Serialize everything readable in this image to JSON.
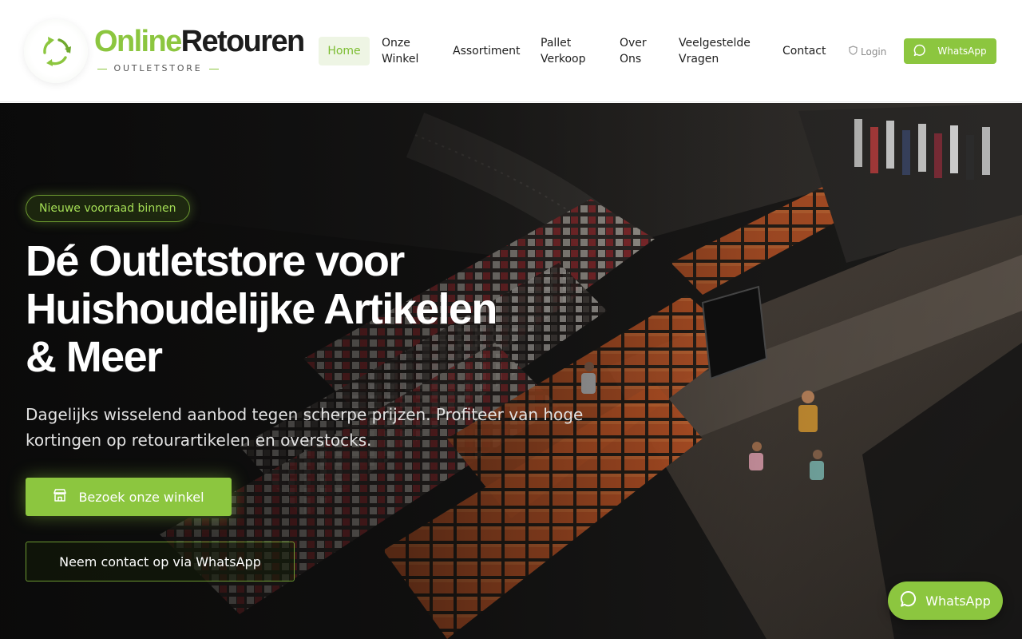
{
  "brand": {
    "name_part1": "Online",
    "name_part2": "Retouren",
    "tagline": "OUTLETSTORE",
    "accent_color": "#8cc63f",
    "logo_icon": "recycle-arrows-icon"
  },
  "nav": {
    "items": [
      {
        "label": "Home",
        "active": true
      },
      {
        "label": "Onze Winkel"
      },
      {
        "label": "Assortiment"
      },
      {
        "label": "Pallet Verkoop"
      },
      {
        "label": "Over Ons"
      },
      {
        "label": "Veelgestelde Vragen"
      },
      {
        "label": "Contact"
      }
    ],
    "login_label": "Login",
    "login_icon": "shield-icon",
    "whatsapp_label": "WhatsApp",
    "whatsapp_icon": "chat-bubble-icon"
  },
  "hero": {
    "badge": "Nieuwe voorraad binnen",
    "title": "Dé Outletstore voor Huishoudelijke Artikelen & Meer",
    "description": "Dagelijks wisselend aanbod tegen scherpe prijzen. Profiteer van hoge kortingen op retourartikelen en overstocks.",
    "primary_button": "Bezoek onze winkel",
    "primary_button_icon": "storefront-icon",
    "secondary_button": "Neem contact op via WhatsApp"
  },
  "floating_whatsapp": {
    "label": "WhatsApp",
    "icon": "chat-bubble-icon"
  }
}
